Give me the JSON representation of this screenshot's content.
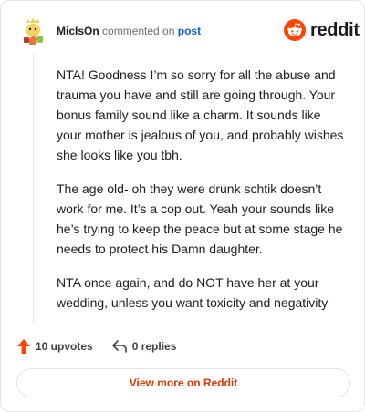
{
  "header": {
    "username": "MicIsOn",
    "action_text": "commented on",
    "post_link": "post"
  },
  "brand": {
    "wordmark": "reddit",
    "logo_icon": "reddit-snoo-icon",
    "accent_color": "#ff4500"
  },
  "comment": {
    "paragraphs": [
      "NTA! Goodness I’m so sorry for all the abuse and trauma you have and still are going through. Your bonus family sound like a charm. It sounds like your mother is jealous of you, and probably wishes she looks like you tbh.",
      "The age old- oh they were drunk schtik doesn’t work for me. It’s a cop out. Yeah your sounds like he’s trying to keep the peace but at some stage he needs to protect his Damn daughter.",
      "NTA once again, and do NOT have her at your wedding, unless you want toxicity and negativity"
    ]
  },
  "actions": {
    "upvotes_label": "10 upvotes",
    "replies_label": "0 replies",
    "upvote_icon": "upvote-arrow-icon",
    "reply_icon": "reply-arrow-icon"
  },
  "footer": {
    "view_more_label": "View more on Reddit"
  }
}
